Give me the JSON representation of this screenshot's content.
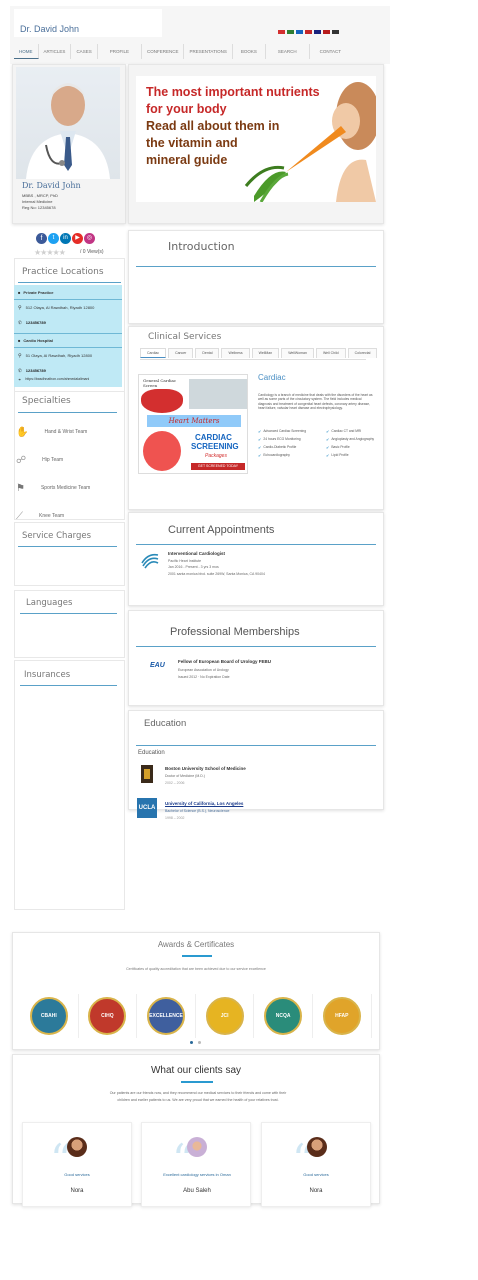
{
  "header": {
    "site_title": "Dr. David John",
    "flags": [
      "#d32f2f",
      "#2e7d32",
      "#1565c0",
      "#c62828",
      "#1a237e",
      "#b71c1c",
      "#333333"
    ]
  },
  "nav": {
    "items": [
      "HOME",
      "ARTICLES",
      "CASES",
      "PROFILE",
      "CONFERENCE",
      "PRESENTATIONS",
      "BOOKS",
      "SEARCH",
      "CONTACT"
    ]
  },
  "profile": {
    "name": "Dr. David John",
    "degrees": "MBBS , MRCP, PhD",
    "specialty": "Internal Medicine",
    "reg": "Reg No: 12345678"
  },
  "banner": {
    "lines": [
      "The most important nutrients",
      "for your body",
      "Read all about them in",
      "the vitamin and",
      "mineral guide"
    ]
  },
  "social": {
    "views": "/ 0 View(s)"
  },
  "practice_locations": {
    "title": "Practice Locations",
    "locations": [
      {
        "name": "Private Practice",
        "address": "512 Olaya, Al Rawdhah, Riyadh 12800",
        "phone": "123456789"
      },
      {
        "name": "Cardio Hospital",
        "address": "51 Olaya, Al Rawdhah, Riyadh 12800",
        "phone": "123456789",
        "url": "https://basdhnathon.com/ahmedalalimani"
      }
    ]
  },
  "specialties": {
    "title": "Specialties",
    "items": [
      "Hand & Wrist Team",
      "Hip Team",
      "Sports Medicine Team",
      "Knee Team"
    ]
  },
  "service_charges": {
    "title": "Service Charges"
  },
  "languages": {
    "title": "Languages"
  },
  "insurances": {
    "title": "Insurances"
  },
  "introduction": {
    "title": "Introduction"
  },
  "clinical_services": {
    "title": "Clinical Services",
    "tabs": [
      "Cardiac",
      "Cancer",
      "Dental",
      "Wellness",
      "WellMan",
      "WellWoman",
      "Well Child",
      "Colorectal"
    ],
    "image_lines": [
      "General Cardiac Screen",
      "Heart Matters",
      "CARDIAC",
      "SCREENING",
      "Packages",
      "GET SCREENED TODAY"
    ],
    "heading": "Cardiac",
    "description": "Cardiology is a branch of medicine that deals with the disorders of the heart as well as some parts of the circulatory system. The field includes medical diagnosis and treatment of congenital heart defects, coronary artery disease, heart failure, valvular heart disease and electrophysiology.",
    "services_left": [
      "Advanced Cardiac Screening",
      "24 hours ECG Monitoring",
      "Cardio-Diabetic Profile",
      "Echocardiography"
    ],
    "services_right": [
      "Cardiac CT and MRI",
      "Angioplasty and Angiography",
      "Basic Profile",
      "Lipid Profile"
    ]
  },
  "appointments": {
    "title": "Current Appointments",
    "role": "Interventional Cardiologist",
    "org": "Pacific Heart Institute",
    "dates": "Jan 2016 - Present - 3 yrs 3 mos",
    "address": "2001 santa monica blvd. suite 269W, Santa Monica, CA 90404"
  },
  "memberships": {
    "title": "Professional Memberships",
    "name": "Fellow of European Board of Urology FEBU",
    "org": "European Association of Urology",
    "issued": "Issued 2012 · No Expiration Date",
    "logo": "EAU"
  },
  "education": {
    "title": "Education",
    "subtitle": "Education",
    "entries": [
      {
        "school": "Boston University School of Medicine",
        "degree": "Doctor of Medicine (M.D.)",
        "years": "2002 – 2006"
      },
      {
        "school": "University of California, Los Angeles",
        "degree": "Bachelor of Science (B.S.), Neuroscience",
        "years": "1998 – 2002",
        "logo": "UCLA"
      }
    ]
  },
  "awards": {
    "title": "Awards & Certificates",
    "subtitle": "Certificates of quality accreditation that are been achieved due to our service excellence",
    "badges": [
      {
        "label": "CBAHI",
        "color": "#2c7a9a"
      },
      {
        "label": "CIHQ",
        "color": "#c0392b"
      },
      {
        "label": "EXCELLENCE",
        "color": "#3f5f9e"
      },
      {
        "label": "JCI",
        "color": "#e6b422"
      },
      {
        "label": "NCQA",
        "color": "#2a8c7a"
      },
      {
        "label": "HFAP",
        "color": "#e0a42a"
      }
    ]
  },
  "testimonials": {
    "title": "What our clients say",
    "intro": "Our patients are our friends now, and they recommend our medical services to their friends and come with their children and earlier patients to us. We are very proud that we earned the health of your relatives trust.",
    "items": [
      {
        "quote": "Good services",
        "name": "Nora"
      },
      {
        "quote": "Excellent cardiology services in Oman",
        "name": "Abu Saleh"
      },
      {
        "quote": "Good services",
        "name": "Nora"
      }
    ]
  }
}
